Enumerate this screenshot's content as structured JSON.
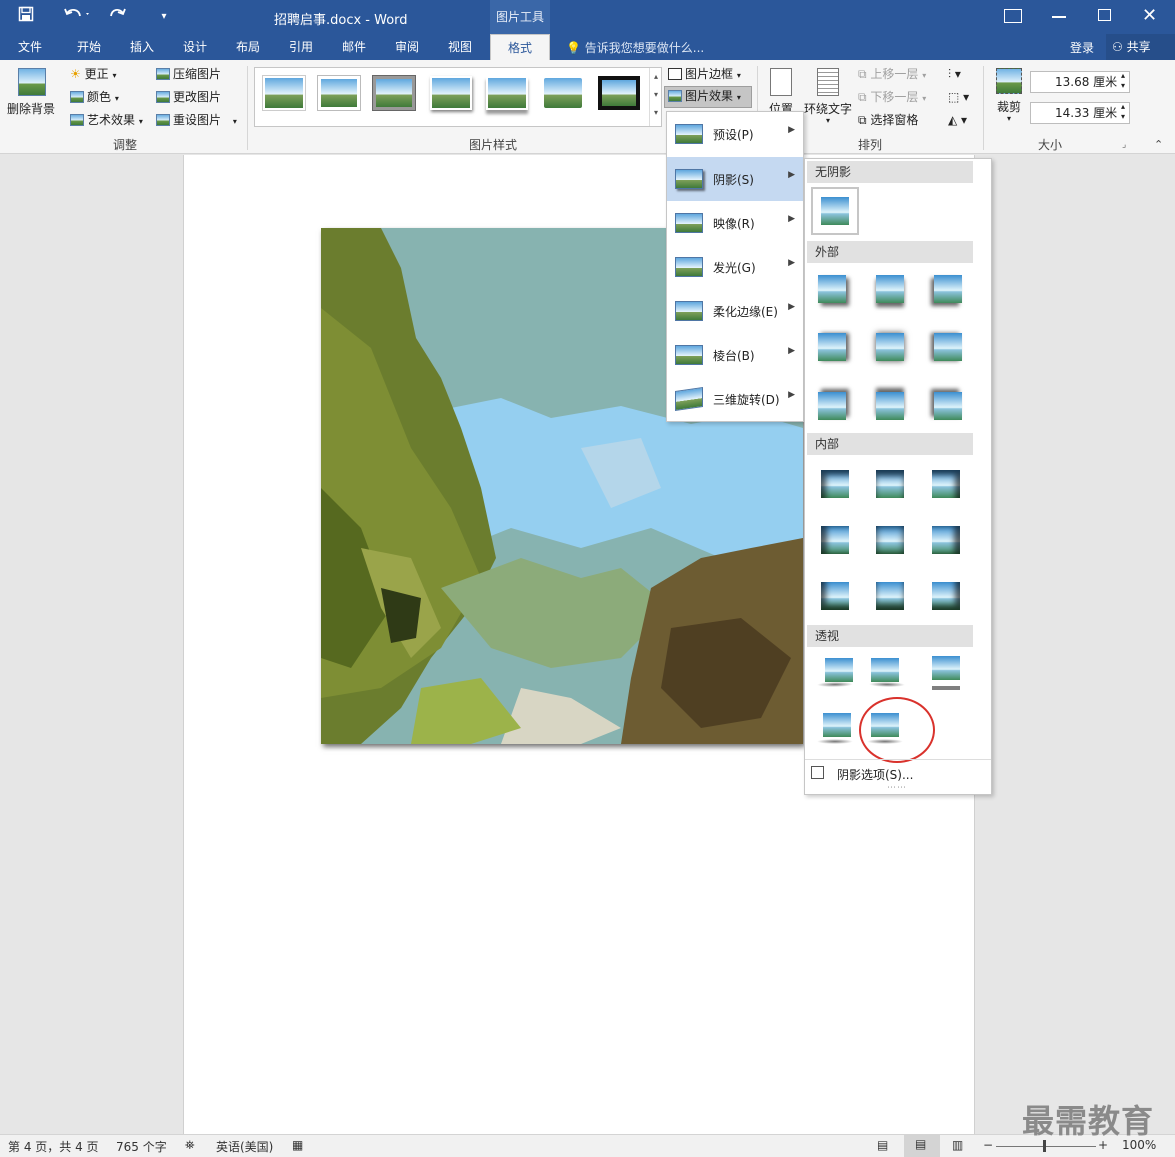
{
  "window": {
    "title": "招聘启事.docx - Word",
    "context_tab": "图片工具",
    "login": "登录",
    "share": "共享"
  },
  "tabs": [
    "文件",
    "开始",
    "插入",
    "设计",
    "布局",
    "引用",
    "邮件",
    "审阅",
    "视图",
    "格式"
  ],
  "active_tab": "格式",
  "tell_me": "告诉我您想要做什么...",
  "ribbon": {
    "adjust": {
      "remove_bg": "删除背景",
      "corrections": "更正",
      "color": "颜色",
      "artistic": "艺术效果",
      "compress": "压缩图片",
      "change": "更改图片",
      "reset": "重设图片",
      "label": "调整"
    },
    "styles": {
      "label": "图片样式",
      "border": "图片边框",
      "effects": "图片效果"
    },
    "arrange": {
      "position": "位置",
      "wrap": "环绕文字",
      "forward": "上移一层",
      "backward": "下移一层",
      "selection": "选择窗格",
      "label": "排列"
    },
    "size": {
      "crop": "裁剪",
      "height": "13.68 厘米",
      "width": "14.33 厘米",
      "label": "大小"
    }
  },
  "effects_menu": {
    "items": [
      "预设(P)",
      "阴影(S)",
      "映像(R)",
      "发光(G)",
      "柔化边缘(E)",
      "棱台(B)",
      "三维旋转(D)"
    ],
    "selected": "阴影(S)"
  },
  "shadow_gallery": {
    "no_shadow": "无阴影",
    "outer": "外部",
    "inner": "内部",
    "perspective": "透视",
    "options": "阴影选项(S)...",
    "highlight_color": "#d9322c"
  },
  "status": {
    "page": "第 4 页，共 4 页",
    "words": "765 个字",
    "language": "英语(美国)",
    "zoom": "100%"
  },
  "watermark": "最需教育",
  "colors": {
    "accent": "#2b579a",
    "menu_highlight": "#c5d9f1"
  }
}
